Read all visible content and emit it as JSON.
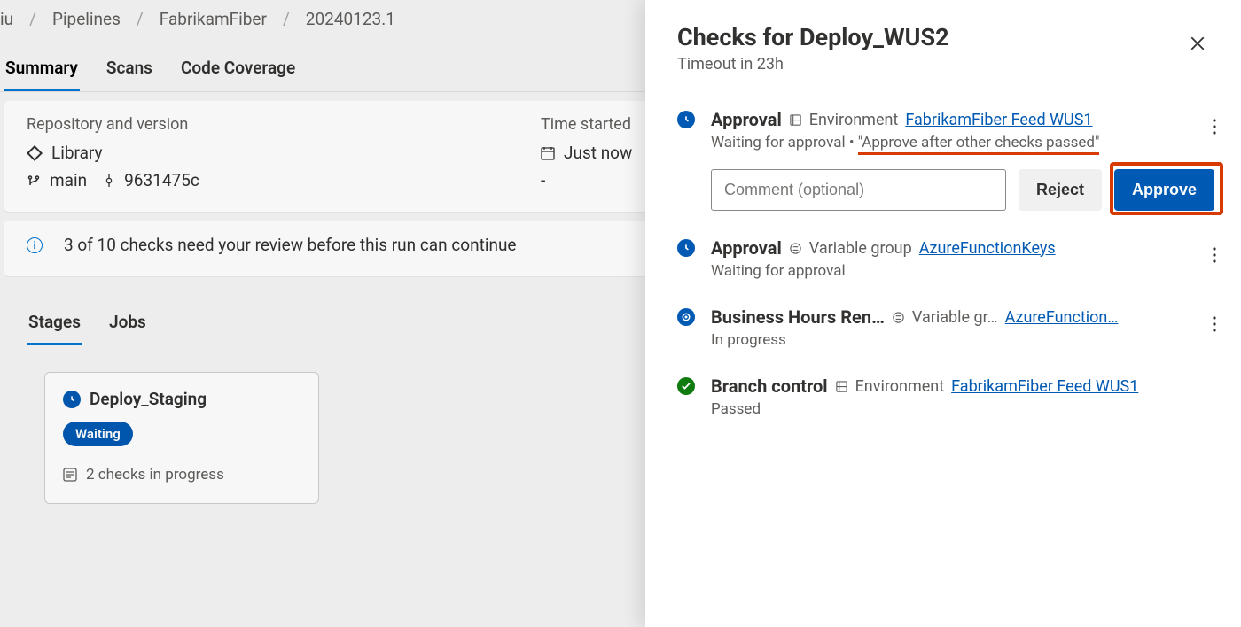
{
  "breadcrumb": {
    "b0": "iu",
    "b1": "Pipelines",
    "b2": "FabrikamFiber",
    "b3": "20240123.1"
  },
  "tabs": {
    "summary": "Summary",
    "scans": "Scans",
    "coverage": "Code Coverage"
  },
  "repo": {
    "heading": "Repository and version",
    "name": "Library",
    "branch": "main",
    "commit": "9631475c"
  },
  "time": {
    "heading": "Time started",
    "value": "Just now",
    "dur": "-"
  },
  "alert": {
    "text": "3 of 10 checks need your review before this run can continue"
  },
  "stageTabs": {
    "stages": "Stages",
    "jobs": "Jobs"
  },
  "stageCard": {
    "title": "Deploy_Staging",
    "badge": "Waiting",
    "sub": "2 checks in progress"
  },
  "panel": {
    "title": "Checks for Deploy_WUS2",
    "timeout": "Timeout in 23h",
    "commentPlaceholder": "Comment (optional)",
    "reject": "Reject",
    "approve": "Approve"
  },
  "checks": [
    {
      "name": "Approval",
      "resourceType": "Environment",
      "resourceLink": "FabrikamFiber Feed WUS1",
      "status1": "Waiting for approval",
      "sep": " • ",
      "status2": "\"Approve after other checks passed\""
    },
    {
      "name": "Approval",
      "resourceType": "Variable group",
      "resourceLink": "AzureFunctionKeys",
      "status": "Waiting for approval"
    },
    {
      "name": "Business Hours Ren…",
      "resourceType": "Variable gr…",
      "resourceLink": "AzureFunction…",
      "status": "In progress"
    },
    {
      "name": "Branch control",
      "resourceType": "Environment",
      "resourceLink": "FabrikamFiber Feed WUS1",
      "status": "Passed"
    }
  ]
}
